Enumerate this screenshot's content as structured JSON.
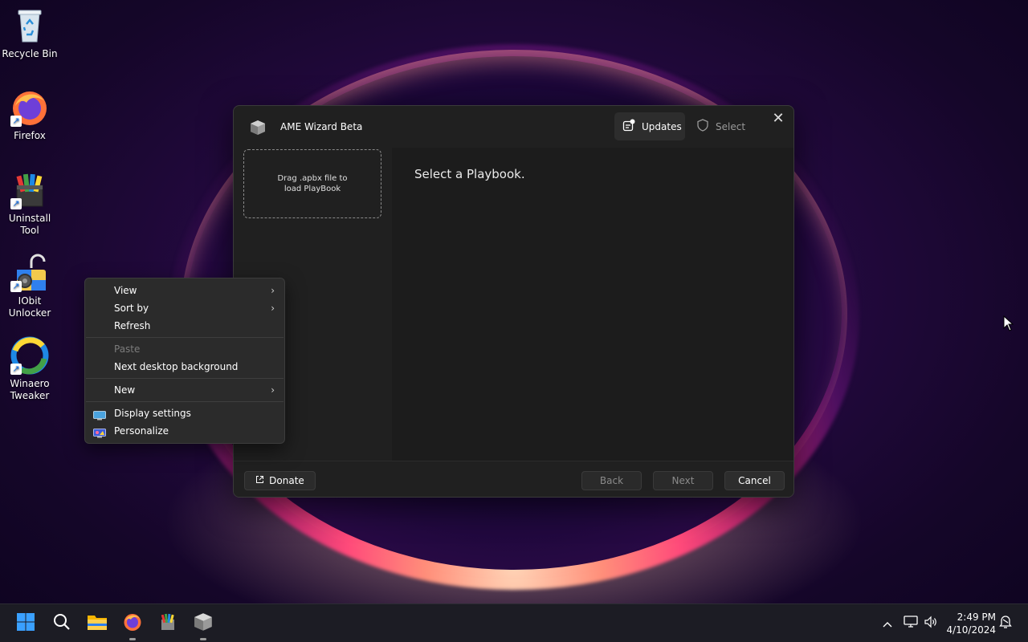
{
  "desktop": {
    "icons": [
      {
        "label": "Recycle Bin",
        "icon": "recycle-bin-icon"
      },
      {
        "label": "Firefox",
        "icon": "firefox-icon"
      },
      {
        "label": "Uninstall Tool",
        "icon": "uninstall-tool-icon"
      },
      {
        "label": "IObit Unlocker",
        "icon": "iobit-unlocker-icon"
      },
      {
        "label": "Winaero Tweaker",
        "icon": "winaero-tweaker-icon"
      }
    ]
  },
  "window": {
    "title": "AME Wizard Beta",
    "updates_label": "Updates",
    "select_label": "Select",
    "drop_zone_text": "Drag .apbx file to load PlayBook",
    "main_heading": "Select a Playbook.",
    "donate_label": "Donate",
    "back_label": "Back",
    "next_label": "Next",
    "cancel_label": "Cancel"
  },
  "context_menu": {
    "view": "View",
    "sort_by": "Sort by",
    "refresh": "Refresh",
    "paste": "Paste",
    "next_background": "Next desktop background",
    "new": "New",
    "display_settings": "Display settings",
    "personalize": "Personalize"
  },
  "taskbar": {
    "time": "2:49 PM",
    "date": "4/10/2024"
  },
  "colors": {
    "window_bg": "#202020",
    "menu_bg": "#2b2b2b",
    "taskbar_bg": "#1c1c24"
  }
}
